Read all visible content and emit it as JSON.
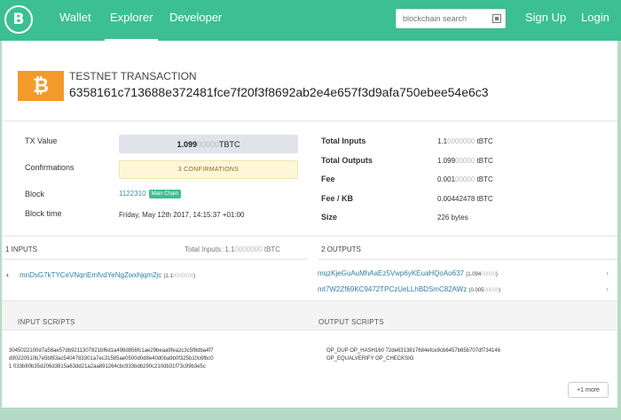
{
  "nav": {
    "logo_letter": "B",
    "links": [
      "Wallet",
      "Explorer",
      "Developer"
    ],
    "search_placeholder": "blockchain search",
    "signup": "Sign Up",
    "login": "Login"
  },
  "tx": {
    "type": "TESTNET TRANSACTION",
    "hash": "6358161c713688e372481fce7f20f3f8692ab2e4e657f3d9afa750ebee54e6c3",
    "coin_symbol": "₿"
  },
  "details": {
    "tx_value_label": "TX Value",
    "tx_value_main": "1.099",
    "tx_value_dim": "00000",
    "tx_value_unit": " TBTC",
    "confirmations_label": "Confirmations",
    "confirmations": "3 CONFIRMATIONS",
    "block_label": "Block",
    "block": "1122310",
    "block_badge": "Main Chain",
    "block_time_label": "Block time",
    "block_time": "Friday, May 12th 2017, 14:15:37 +01:00"
  },
  "summary": {
    "total_inputs_label": "Total Inputs",
    "total_inputs_main": "1.1",
    "total_inputs_dim": "0000000",
    "total_inputs_unit": " tBTC",
    "total_outputs_label": "Total Outputs",
    "total_outputs_main": "1.099",
    "total_outputs_dim": "00000",
    "total_outputs_unit": " tBTC",
    "fee_label": "Fee",
    "fee_main": "0.001",
    "fee_dim": "00000",
    "fee_unit": " tBTC",
    "fee_kb_label": "Fee / KB",
    "fee_kb": "0.00442478 tBTC",
    "size_label": "Size",
    "size": "226 bytes"
  },
  "inputs": {
    "header": "1 INPUTS",
    "total_label": "Total Inputs: 1.1",
    "total_dim": "0000000",
    "total_unit": " tBTC",
    "items": [
      {
        "address": "mnDsG7kTYCeVNqnEmfvdYeNgZwxhjqm2jc",
        "amount_main": "(1.1",
        "amount_dim": "0000000",
        "amount_close": ")"
      }
    ]
  },
  "outputs": {
    "header": "2 OUTPUTS",
    "items": [
      {
        "address": "mqzKjeGuAuMhAaEz5Vwp6yKEuaHQoAo637",
        "amount_main": "(1.094",
        "amount_dim": "00000",
        "amount_close": ")"
      },
      {
        "address": "mt7W2Zf69KC9472TPCzUeLLhBDSmC82AWz",
        "amount_main": "(0.005",
        "amount_dim": "00000",
        "amount_close": ")"
      }
    ]
  },
  "scripts": {
    "input_header": "INPUT SCRIPTS",
    "output_header": "OUTPUT SCRIPTS",
    "input_lines": [
      "3045022100d7a58ae57db9211307821bf6d1a498d856fc1ae29beaa9fea2c3c5f8dba4f7",
      "d90220510b7e5bf83ac5404783301a7ec31585ae0500d0d8e40d0ba9b0f325b10c6fbc0",
      "1 033b80b35d206d3815a63dd21a2aa891264cbc933bdb290c210db31f73c99b3e5c"
    ],
    "output_lines": [
      "OP_DUP OP_HASH160 72de6313817684efce9cb6457b65b707df734146",
      "OP_EQUALVERIFY OP_CHECKSIG"
    ],
    "more_button": "+1 more"
  }
}
